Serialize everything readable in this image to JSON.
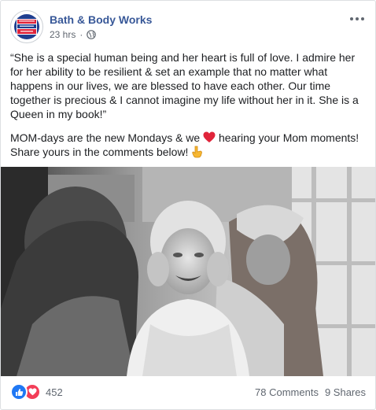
{
  "post": {
    "page_name": "Bath & Body Works",
    "timestamp": "23 hrs",
    "meta_separator": "·",
    "body": {
      "paragraph1": "“She is a special human being and her heart is full of love. I admire her for her ability to be resilient & set an example that no matter what happens in our lives, we are blessed to have each other. Our time together is precious & I cannot imagine my life without her in it. She is a Queen in my book!”",
      "paragraph2_before_emoji": "MOM-days are the new Mondays & we ",
      "paragraph2_after_emoji": " hearing your Mom moments! Share yours in the comments below! "
    },
    "footer": {
      "reaction_count": "452",
      "comments": "78 Comments",
      "shares": "9 Shares"
    },
    "colors": {
      "link_blue": "#385898",
      "like_blue": "#2078f4",
      "love_red": "#f33e58",
      "meta_gray": "#606770"
    },
    "icons": {
      "avatar": "bath-and-body-works-logo",
      "privacy": "globe-icon",
      "menu": "more-options-icon",
      "reaction_1": "like-icon",
      "reaction_2": "love-icon",
      "emoji_1": "red-heart-emoji",
      "emoji_2": "pointing-down-emoji"
    }
  }
}
